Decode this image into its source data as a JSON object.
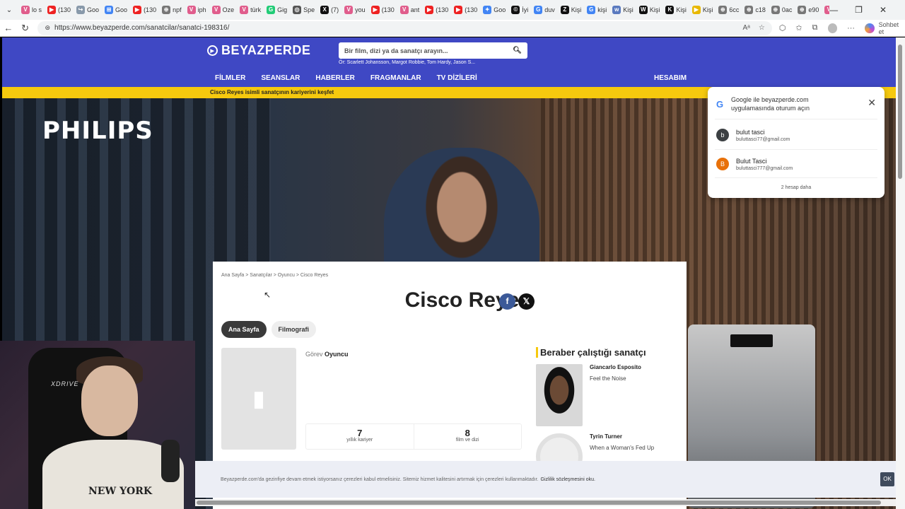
{
  "browser": {
    "tabs": [
      {
        "label": "lo s",
        "color": "#e05d8c",
        "glyph": "V"
      },
      {
        "label": "(130",
        "color": "#e22",
        "glyph": "▶"
      },
      {
        "label": "Goo",
        "color": "#8899aa",
        "glyph": "↪"
      },
      {
        "label": "Goo",
        "color": "#4285f4",
        "glyph": "⊞"
      },
      {
        "label": "(130",
        "color": "#e22",
        "glyph": "▶"
      },
      {
        "label": "npf",
        "color": "#777",
        "glyph": "⊕"
      },
      {
        "label": "iph",
        "color": "#e05d8c",
        "glyph": "V"
      },
      {
        "label": "Oze",
        "color": "#e05d8c",
        "glyph": "V"
      },
      {
        "label": "türk",
        "color": "#e05d8c",
        "glyph": "V"
      },
      {
        "label": "Gig",
        "color": "#2c7",
        "glyph": "G"
      },
      {
        "label": "Spe",
        "color": "#555",
        "glyph": "◎"
      },
      {
        "label": "(7)",
        "color": "#111",
        "glyph": "X"
      },
      {
        "label": "you",
        "color": "#e05d8c",
        "glyph": "V"
      },
      {
        "label": "(130",
        "color": "#e22",
        "glyph": "▶"
      },
      {
        "label": "ant",
        "color": "#e05d8c",
        "glyph": "V"
      },
      {
        "label": "(130",
        "color": "#e22",
        "glyph": "▶"
      },
      {
        "label": "(130",
        "color": "#e22",
        "glyph": "▶"
      },
      {
        "label": "Goo",
        "color": "#4285f4",
        "glyph": "✦"
      },
      {
        "label": "İyi",
        "color": "#111",
        "glyph": "©"
      },
      {
        "label": "duv",
        "color": "#4285f4",
        "glyph": "G"
      },
      {
        "label": "Kişi",
        "color": "#111",
        "glyph": "Z"
      },
      {
        "label": "kişi",
        "color": "#4285f4",
        "glyph": "G"
      },
      {
        "label": "Kişi",
        "color": "#5a7abf",
        "glyph": "w"
      },
      {
        "label": "Kişi",
        "color": "#111",
        "glyph": "W"
      },
      {
        "label": "Kişi",
        "color": "#111",
        "glyph": "K"
      },
      {
        "label": "Kişi",
        "color": "#e8b800",
        "glyph": "▶"
      },
      {
        "label": "6cc",
        "color": "#777",
        "glyph": "⊕"
      },
      {
        "label": "c18",
        "color": "#777",
        "glyph": "⊕"
      },
      {
        "label": "0ac",
        "color": "#777",
        "glyph": "⊕"
      },
      {
        "label": "e90",
        "color": "#777",
        "glyph": "⊕"
      },
      {
        "label": "Kişi",
        "color": "#e05d8c",
        "glyph": "V"
      },
      {
        "label": "cisc",
        "color": "#3f48c4",
        "glyph": "B",
        "active": true
      }
    ],
    "new_tab": "+",
    "window_controls": [
      "—",
      "❐",
      "✕"
    ],
    "url": "https://www.beyazperde.com/sanatcilar/sanatci-198316/",
    "chat_label": "Sohbet et"
  },
  "site": {
    "logo_text": "BEYAZPERDE",
    "search_placeholder": "Bir film, dizi ya da sanatçı arayın...",
    "search_example": "Ör: Scarlett Johansson, Margot Robbie, Tom Hardy, Jason S...",
    "menu": [
      "FİLMLER",
      "SEANSLAR",
      "HABERLER",
      "FRAGMANLAR",
      "TV DİZİLERİ"
    ],
    "account": "HESABIM",
    "banner": "Cisco Reyes isimli sanatçının kariyerini keşfet",
    "ad_brand": "PHILIPS"
  },
  "artist": {
    "breadcrumb": "Ana Sayfa  >  Sanatçılar  >  Oyuncu  >   Cisco Reyes",
    "name": "Cisco Reyes",
    "tabs": [
      "Ana Sayfa",
      "Filmografi"
    ],
    "role_label": "Görev",
    "role_value": "Oyuncu",
    "stats": [
      {
        "value": "7",
        "label": "yıllık kariyer"
      },
      {
        "value": "8",
        "label": "film ve dizi"
      }
    ],
    "coworkers_title": "Beraber çalıştığı sanatçı",
    "coworkers": [
      {
        "name": "Giancarlo Esposito",
        "movie": "Feel the Noise"
      },
      {
        "name": "Tyrin Turner",
        "movie": "When a Woman's Fed Up"
      }
    ]
  },
  "cookie": {
    "text": "Beyazperde.com'da gezinfiye devam etmek istiyorsanız çerezleri kabul etmelisiniz. Sitemiz hizmet kalitesini artırmak için çerezleri kullanmaktadır.",
    "link": "Gizlilik sözleşmesini oku.",
    "ok": "OK"
  },
  "google_popup": {
    "title": "Google ile beyazperde.com uygulamasında oturum açın",
    "accounts": [
      {
        "initial": "b",
        "name": "bulut tasci",
        "email": "buluttasci77@gmail.com",
        "color": "#3c4043"
      },
      {
        "initial": "B",
        "name": "Bulut Tasci",
        "email": "buluttasci777@gmail.com",
        "color": "#e8710a"
      }
    ],
    "more": "2 hesap daha"
  },
  "webcam": {
    "brand": "XDRIVE",
    "shirt_text": "NEW YORK"
  }
}
